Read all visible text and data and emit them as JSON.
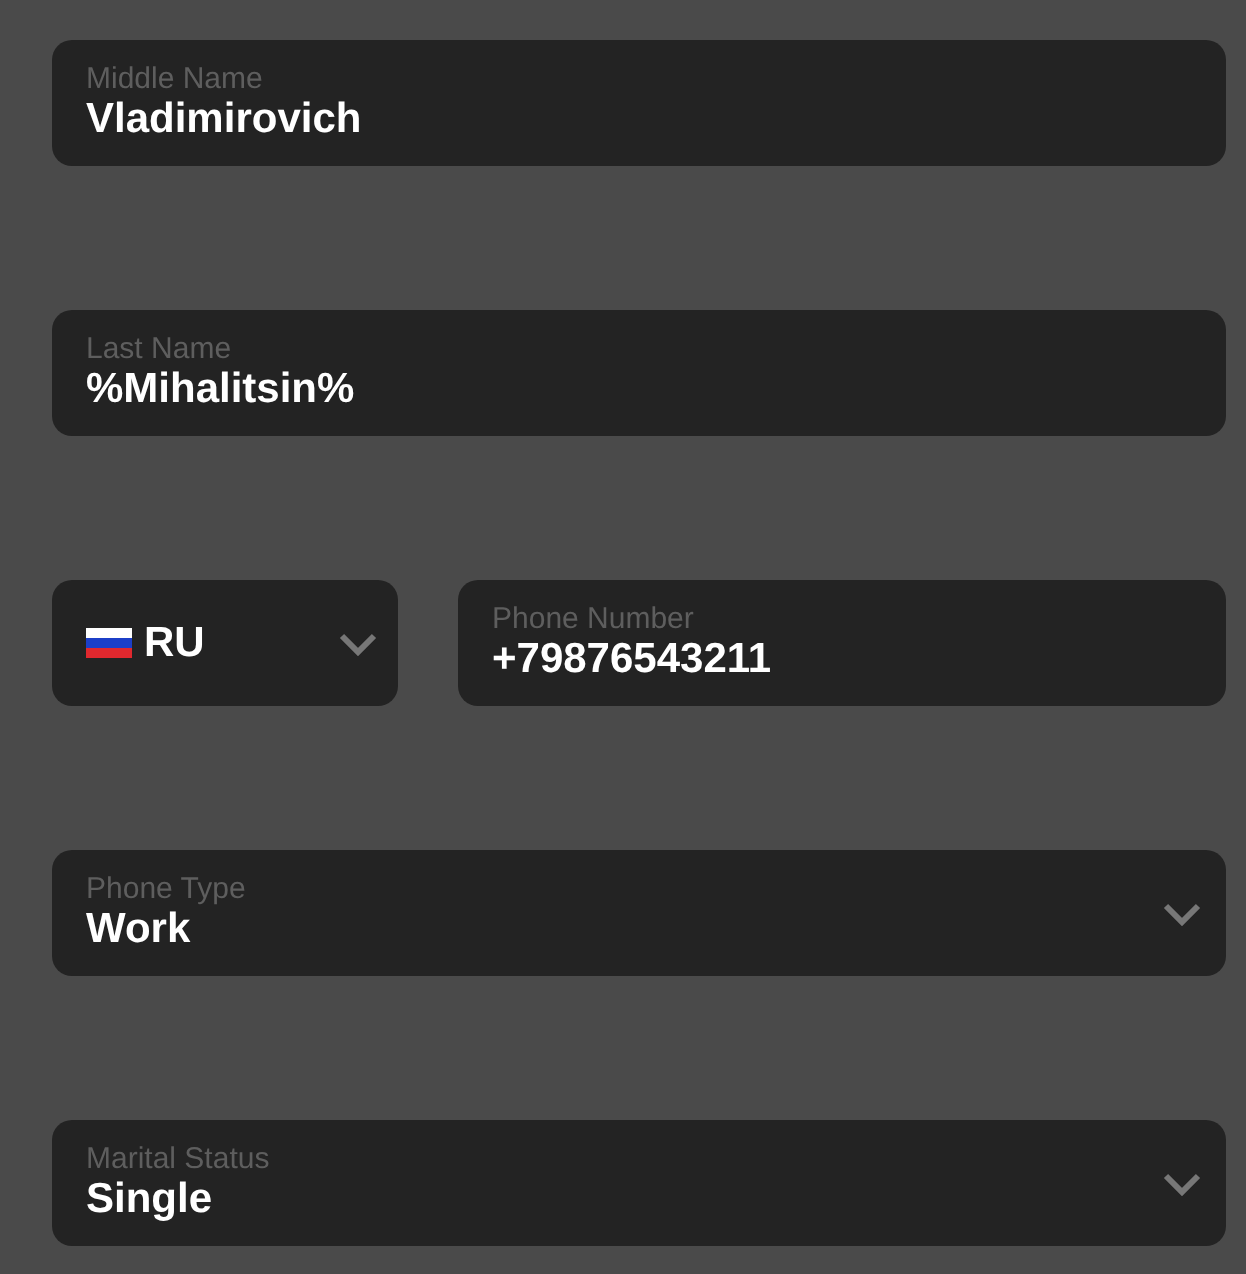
{
  "fields": [
    {
      "kind": "text",
      "label": "Middle Name",
      "value": "Vladimirovich"
    },
    {
      "kind": "text",
      "label": "Last Name",
      "value": "%Mihalitsin%"
    },
    {
      "kind": "phone",
      "country": "RU",
      "label": "Phone Number",
      "value": "+79876543211"
    },
    {
      "kind": "select",
      "label": "Phone Type",
      "value": "Work"
    },
    {
      "kind": "select",
      "label": "Marital Status",
      "value": "Single"
    }
  ]
}
